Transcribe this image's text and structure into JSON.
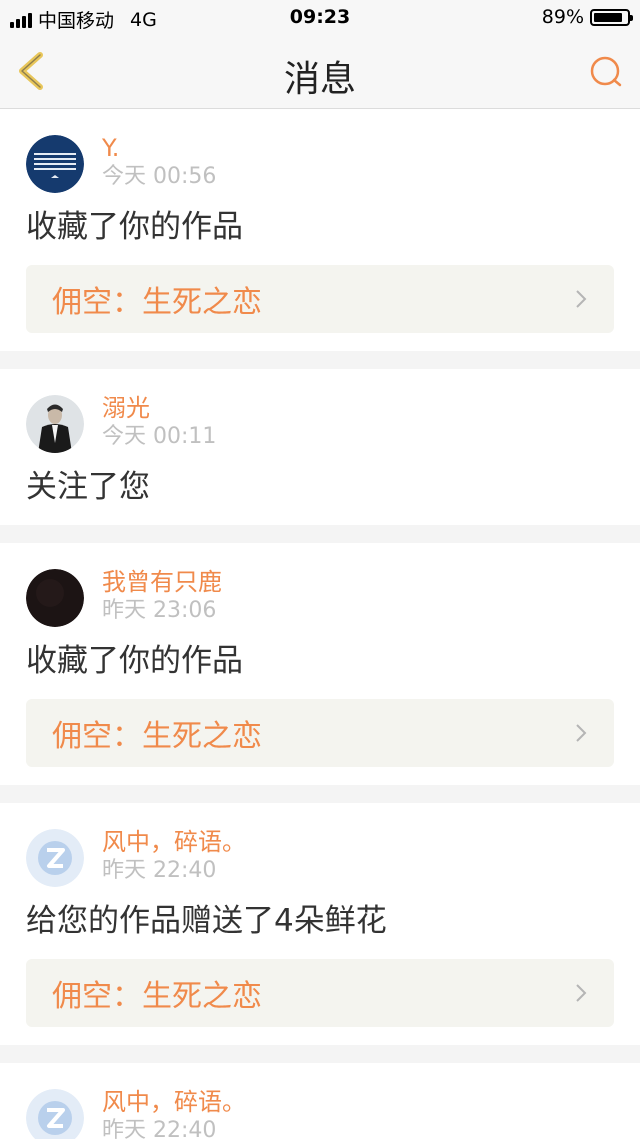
{
  "status_bar": {
    "carrier": "中国移动",
    "network": "4G",
    "time": "09:23",
    "battery": "89%",
    "battery_level": 0.89
  },
  "nav": {
    "title": "消息",
    "accent": "#f08a4b",
    "back_icon": "chevron-left-icon",
    "search_icon": "search-icon"
  },
  "messages": [
    {
      "name": "Y.",
      "time": "今天 00:56",
      "action": "收藏了你的作品",
      "work": "佣空：生死之恋"
    },
    {
      "name": "溺光",
      "time": "今天 00:11",
      "action": "关注了您"
    },
    {
      "name": "我曾有只鹿",
      "time": "昨天 23:06",
      "action": "收藏了你的作品",
      "work": "佣空：生死之恋"
    },
    {
      "name": "风中，碎语。",
      "time": "昨天 22:40",
      "action": "给您的作品赠送了4朵鲜花",
      "work": "佣空：生死之恋"
    },
    {
      "name": "风中，碎语。",
      "time": "昨天 22:40"
    }
  ]
}
